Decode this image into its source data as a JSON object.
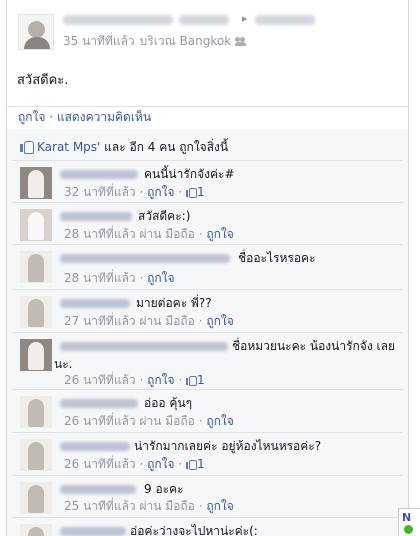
{
  "post": {
    "time": "35 นาทีที่แล้ว",
    "location": "บริเวณ Bangkok",
    "body": "สวัสดีคะ.",
    "like_label": "ถูกใจ",
    "separator": " · ",
    "comment_label": "แสดงความคิดเห็น"
  },
  "likes": {
    "name": "Karat Mps'",
    "rest": " และ อีก 4 คน ถูกใจสิ่งนี้"
  },
  "comment_ui": {
    "like": "ถูกใจ",
    "via_mobile": "ผ่าน มือถือ",
    "dot": " · "
  },
  "comments": [
    {
      "text": "คนนี้น่ารักจังค่ะ#",
      "time": "32 นาทีที่แล้ว",
      "likes": "1"
    },
    {
      "text": "สวัสดีคะ:)",
      "time": "28 นาทีที่แล้ว"
    },
    {
      "text": "ชื่ออะไรหรอคะ",
      "time": "28 นาทีที่แล้ว"
    },
    {
      "text": "มายต่อคะ พี่??",
      "time": "27 นาทีที่แล้ว"
    },
    {
      "text": "ชื่อหมวยนะคะ น้องน่ารักจัง เลยนะ.",
      "time": "26 นาทีที่แล้ว",
      "likes": "1"
    },
    {
      "text": "อ่ออ คุ้นๆ",
      "time": "26 นาทีที่แล้ว"
    },
    {
      "text": "น่ารักมากเลยค่ะ อยู่ห้องไหนหรอค่ะ?",
      "time": "26 นาทีที่แล้ว",
      "likes": "1"
    },
    {
      "text": "9 อะคะ",
      "time": "25 นาทีที่แล้ว"
    },
    {
      "text": "อ่อค่ะว่างจะไปหาน่ะค่ะ(:"
    }
  ],
  "side_badge": "N"
}
